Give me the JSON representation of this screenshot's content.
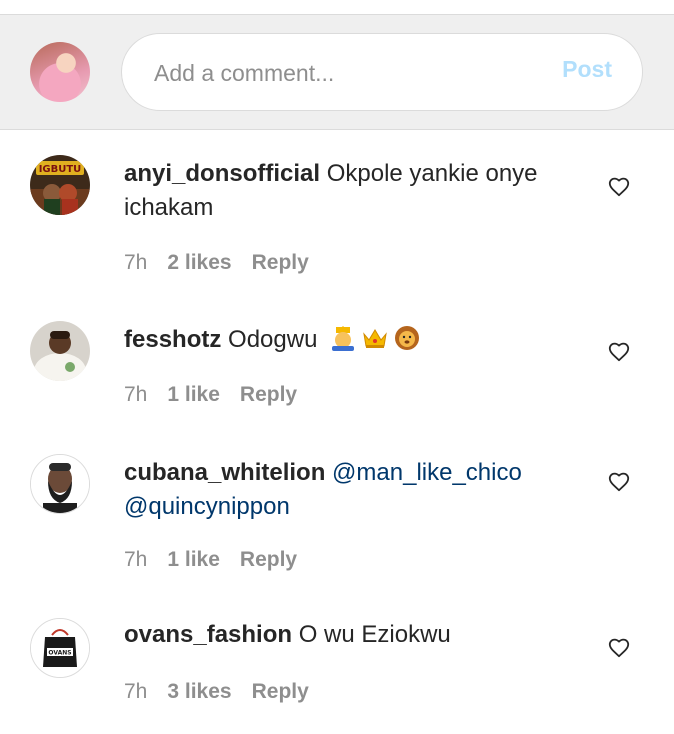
{
  "composer": {
    "placeholder": "Add a comment...",
    "post_label": "Post"
  },
  "comments": [
    {
      "username": "anyi_donsofficial",
      "text": "Okpole yankie onye ichakam",
      "time": "7h",
      "likes": "2 likes",
      "reply": "Reply",
      "avatar_text": "IGBUTU"
    },
    {
      "username": "fesshotz",
      "text": "Odogwu",
      "emojis": [
        "person-with-crown-emoji",
        "crown-emoji",
        "lion-face-emoji"
      ],
      "time": "7h",
      "likes": "1 like",
      "reply": "Reply"
    },
    {
      "username": "cubana_whitelion",
      "mentions": [
        "@man_like_chico",
        "@quincynippon"
      ],
      "time": "7h",
      "likes": "1 like",
      "reply": "Reply"
    },
    {
      "username": "ovans_fashion",
      "text": "O wu Eziokwu",
      "time": "7h",
      "likes": "3 likes",
      "reply": "Reply",
      "avatar_text": "OVANS"
    }
  ],
  "colors": {
    "post_disabled": "#b2dffc",
    "mention": "#00376b",
    "secondary_text": "#8e8e8e",
    "composer_bg": "#efefef"
  },
  "icons": [
    "heart-outline-icon"
  ]
}
